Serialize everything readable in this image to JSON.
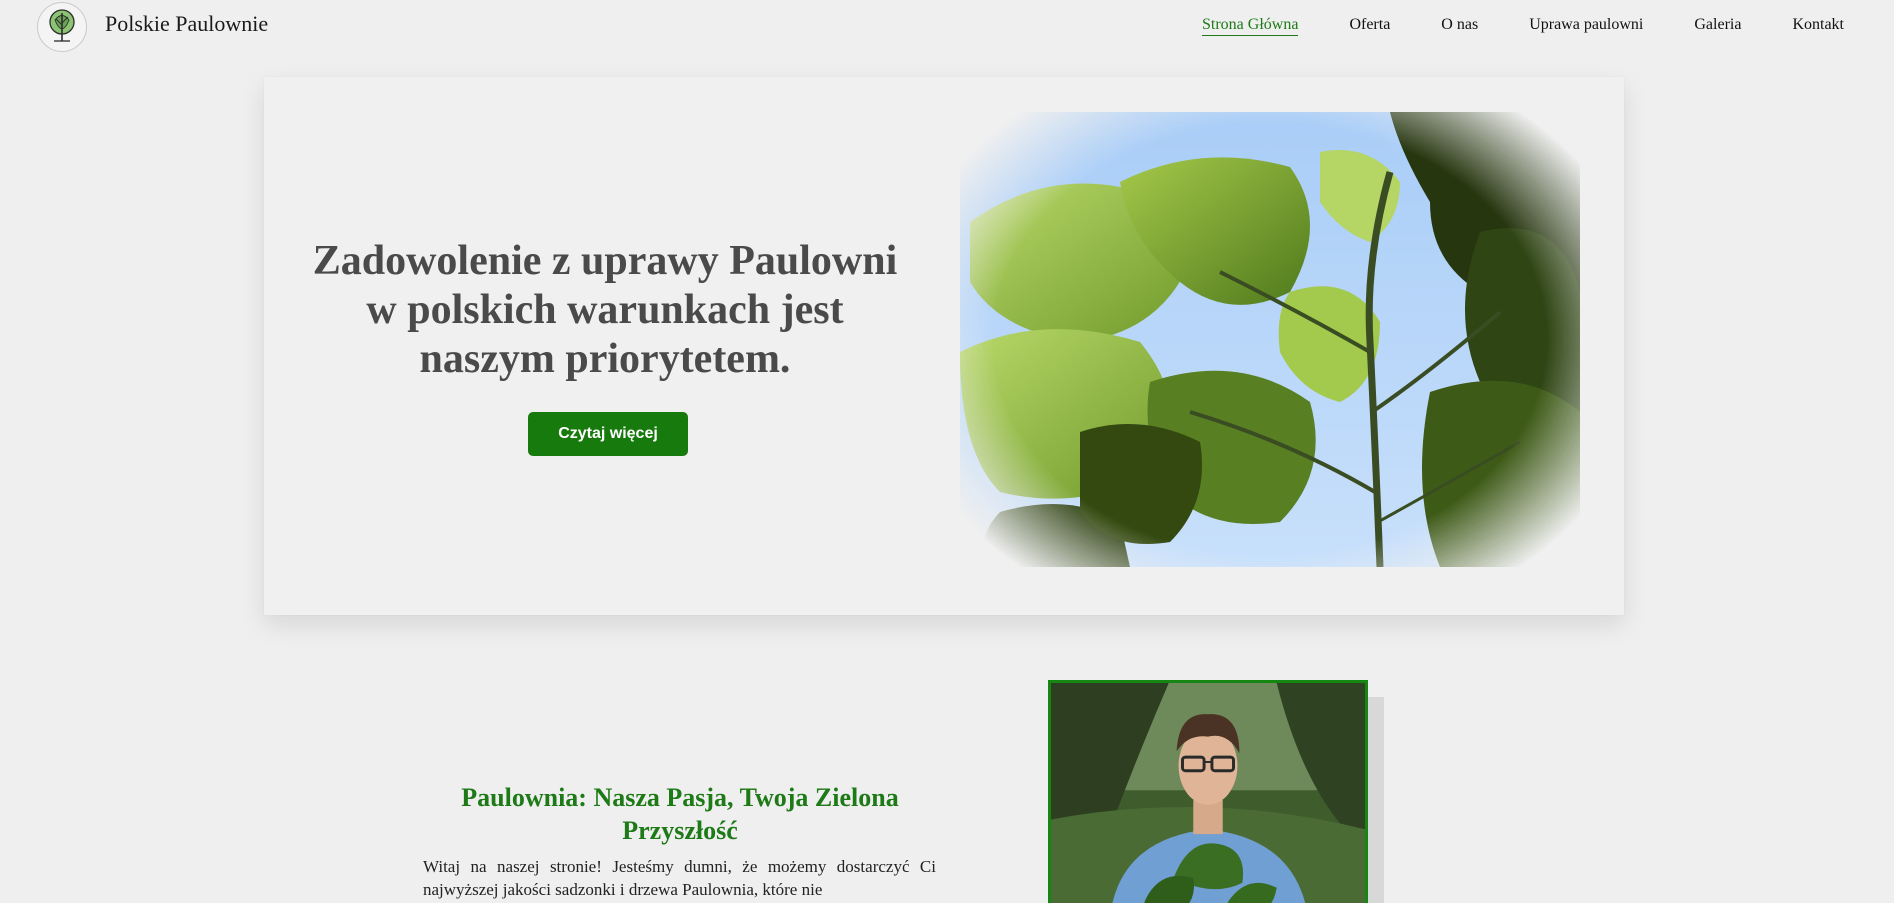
{
  "header": {
    "site_title": "Polskie Paulownie",
    "logo_icon": "tree-logo-icon",
    "nav": [
      {
        "label": "Strona Główna",
        "active": true
      },
      {
        "label": "Oferta",
        "active": false
      },
      {
        "label": "O nas",
        "active": false
      },
      {
        "label": "Uprawa paulowni",
        "active": false
      },
      {
        "label": "Galeria",
        "active": false
      },
      {
        "label": "Kontakt",
        "active": false
      }
    ]
  },
  "hero": {
    "heading": "Zadowolenie z uprawy Paulowni w polskich warunkach jest naszym priorytetem.",
    "button_label": "Czytaj więcej"
  },
  "about": {
    "heading": "Paulownia: Nasza Pasja, Twoja Zielona Przyszłość",
    "text": "Witaj na naszej stronie! Jesteśmy dumni, że możemy dostarczyć Ci najwyższej jakości sadzonki i drzewa Paulownia, które nie"
  },
  "colors": {
    "accent": "#167a0d",
    "heading_green": "#1e7a17",
    "background": "#efefef",
    "hero_text": "#4a4a4a"
  }
}
